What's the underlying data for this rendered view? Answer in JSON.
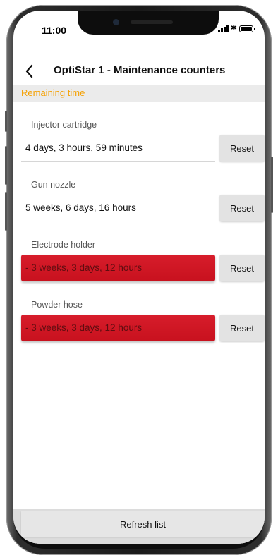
{
  "status_bar": {
    "time": "11:00",
    "signal_icon": "signal-bars-icon",
    "bluetooth_icon": "bluetooth-icon",
    "bluetooth_glyph": "✱",
    "battery_icon": "battery-icon"
  },
  "header": {
    "back_icon": "chevron-left-icon",
    "title": "OptiStar 1   - Maintenance counters"
  },
  "section": {
    "title": "Remaining time"
  },
  "counters": [
    {
      "label": "Injector cartridge",
      "value": "4 days, 3 hours, 59 minutes",
      "overdue": false,
      "reset_label": "Reset"
    },
    {
      "label": "Gun nozzle",
      "value": "5 weeks, 6 days, 16 hours",
      "overdue": false,
      "reset_label": "Reset"
    },
    {
      "label": "Electrode holder",
      "value": "- 3 weeks, 3 days, 12 hours",
      "overdue": true,
      "reset_label": "Reset"
    },
    {
      "label": "Powder hose",
      "value": "- 3 weeks, 3 days, 12 hours",
      "overdue": true,
      "reset_label": "Reset"
    }
  ],
  "footer": {
    "refresh_label": "Refresh list"
  },
  "colors": {
    "accent_orange": "#f5a000",
    "overdue_red": "#d71d2b",
    "button_gray": "#e3e3e3"
  }
}
